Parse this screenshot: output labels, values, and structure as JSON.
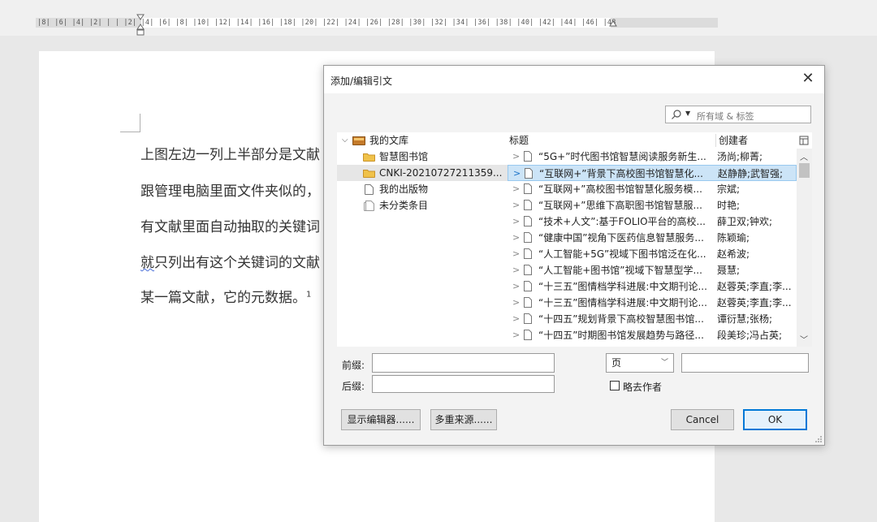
{
  "ruler": {
    "ticks": "|8|  |6|  |4|  |2|  | |  |2|  |4|  |6|  |8|  |10|  |12|  |14|  |16|  |18|  |20|  |22|  |24|  |26|  |28|  |30|  |32|  |34|  |36|  |38|  |40|  |42|  |44|  |46|  |48"
  },
  "document": {
    "lines": [
      "上图左边一列上半部分是文献",
      "跟管理电脑里面文件夹似的，",
      "有文献里面自动抽取的关键词",
      "就只列出有这个关键词的文献",
      "某一篇文献，它的元数据。"
    ],
    "line4_first": "就",
    "line4_rest": "只列出有这个关键词的文献",
    "footnote": "1"
  },
  "dialog": {
    "title": "添加/编辑引文",
    "search_placeholder": "所有域 & 标签",
    "tree": {
      "root": "我的文库",
      "items": [
        "智慧图书馆",
        "CNKI-20210727211359...",
        "我的出版物",
        "未分类条目"
      ]
    },
    "columns": {
      "title": "标题",
      "creator": "创建者"
    },
    "rows": [
      {
        "title": "“5G+”时代图书馆智慧阅读服务新生...",
        "creator": "汤尚;柳菁;"
      },
      {
        "title": "“互联网+”背景下高校图书馆智慧化...",
        "creator": "赵静静;武智强;"
      },
      {
        "title": "“互联网+”高校图书馆智慧化服务模...",
        "creator": "宗斌;"
      },
      {
        "title": "“互联网+”思维下高职图书馆智慧服...",
        "creator": "时艳;"
      },
      {
        "title": "“技术+人文”:基于FOLIO平台的高校...",
        "creator": "薛卫双;钟欢;"
      },
      {
        "title": "“健康中国”视角下医药信息智慧服务...",
        "creator": "陈颖瑜;"
      },
      {
        "title": "“人工智能+5G”视域下图书馆泛在化...",
        "creator": "赵希波;"
      },
      {
        "title": "“人工智能+图书馆”视域下智慧型学...",
        "creator": "聂慧;"
      },
      {
        "title": "“十三五”图情档学科进展:中文期刊论...",
        "creator": "赵蓉英;李直;李..."
      },
      {
        "title": "“十三五”图情档学科进展:中文期刊论...",
        "creator": "赵蓉英;李直;李..."
      },
      {
        "title": "“十四五”规划背景下高校智慧图书馆...",
        "creator": "谭衍慧;张杨;"
      },
      {
        "title": "“十四五”时期图书馆发展趋势与路径...",
        "creator": "段美珍;冯占英;"
      }
    ],
    "prefix_label": "前缀:",
    "suffix_label": "后缀:",
    "locator_value": "页",
    "omit_author_label": "略去作者",
    "show_editor_label": "显示编辑器......",
    "multi_source_label": "多重来源......",
    "cancel_label": "Cancel",
    "ok_label": "OK"
  },
  "colors": {
    "folder": "#e3a92b",
    "selection": "#cce4f7",
    "ok_border": "#0078d7"
  },
  "icons": [
    "search-icon",
    "folder-icon",
    "document-icon",
    "library-icon",
    "close-icon",
    "chevron-down-icon",
    "column-picker-icon"
  ]
}
